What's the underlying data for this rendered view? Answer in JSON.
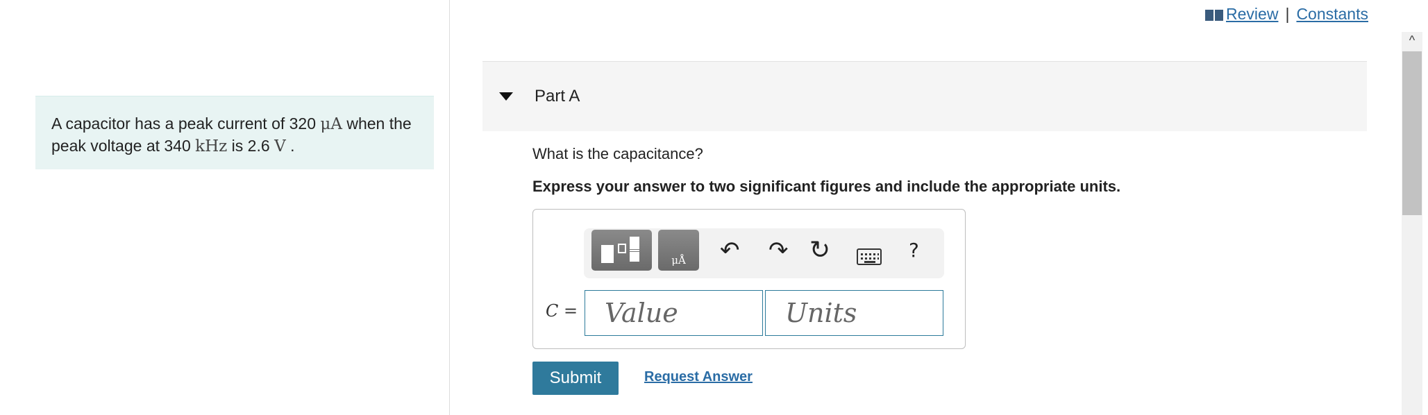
{
  "header": {
    "review_label": "Review",
    "separator": "|",
    "constants_label": "Constants"
  },
  "problem": {
    "part1": "A capacitor has a peak current of 320 ",
    "current_unit": "μA",
    "part2": " when the peak voltage at 340 ",
    "freq_unit": "kHz",
    "part3": " is 2.6 ",
    "voltage_unit": "V",
    "part4": " ."
  },
  "part": {
    "title": "Part A",
    "question": "What is the capacitance?",
    "instruction": "Express your answer to two significant figures and include the appropriate units."
  },
  "answer": {
    "variable": "C",
    "equals": "=",
    "value_placeholder": "Value",
    "units_placeholder": "Units",
    "angstrom_glyph": "μÅ"
  },
  "toolbar": {
    "undo_glyph": "↶",
    "redo_glyph": "↷",
    "reset_glyph": "↻",
    "help_glyph": "?"
  },
  "actions": {
    "submit_label": "Submit",
    "request_answer_label": "Request Answer"
  },
  "scrollbar": {
    "up_glyph": "^"
  },
  "colors": {
    "link": "#2a6ca5",
    "submit_bg": "#2f7a9c",
    "problem_bg": "#e8f4f3"
  }
}
